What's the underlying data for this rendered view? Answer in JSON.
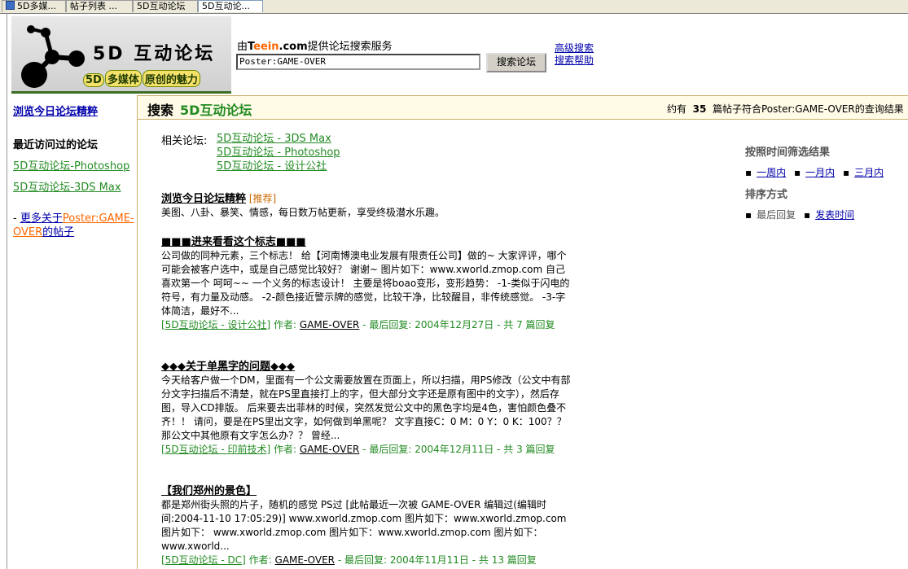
{
  "tabs": [
    {
      "label": "5D多媒..."
    },
    {
      "label": "帖子列表 ..."
    },
    {
      "label": "5D互动论坛"
    },
    {
      "label": "5D互动论..."
    }
  ],
  "logo": {
    "title": "5D 互动论坛",
    "slogan": [
      "5D",
      "多媒体",
      "原创的魅力"
    ]
  },
  "search": {
    "service_prefix": "由",
    "brand_a": "T",
    "brand_b": "eein",
    "brand_c": ".com",
    "service_suffix": "提供论坛搜索服务",
    "query": "Poster:GAME-OVER",
    "button": "搜索论坛",
    "advanced": "高级搜索",
    "help": "搜索帮助"
  },
  "sidebar": {
    "browse": "浏览今日论坛精粹",
    "recent_title": "最近访问过的论坛",
    "recent": [
      "5D互动论坛-Photoshop",
      "5D互动论坛-3DS Max"
    ],
    "more_prefix": "- ",
    "more_link1": "更多关于",
    "more_link2": "Poster:GAME-OVER",
    "more_link3": "的帖子"
  },
  "header": {
    "search_label": "搜索",
    "forum": "5D互动论坛",
    "count_prefix": "约有",
    "count": "35",
    "count_suffix": "篇帖子符合Poster:GAME-OVER的查询结果"
  },
  "related": {
    "label": "相关论坛:",
    "links": [
      "5D互动论坛 - 3DS Max",
      "5D互动论坛 - Photoshop",
      "5D互动论坛 - 设计公社"
    ]
  },
  "promo": {
    "title": "浏览今日论坛精粹",
    "tag": "[推荐]",
    "desc": "美图、八卦、暴笑、情感，每日数万帖更新，享受终极潜水乐趣。"
  },
  "results": [
    {
      "title": "■■■进来看看这个标志■■■",
      "snippet": "公司做的同种元素，三个标志！ 给【河南博澳电业发展有限责任公司】做的~ 大家评评，哪个可能会被客户选中，或是自己感觉比较好？ 谢谢~ 图片如下：www.xworld.zmop.com 自己喜欢第一个 呵呵~~ 一个义务的标志设计！ 主要是将boao变形，变形趋势： -1-类似于闪电的符号，有力量及动感。 -2-颜色接近警示牌的感觉，比较干净，比较醒目，非传统感觉。 -3-字体简洁，最好不...",
      "forum": "[5D互动论坛 - 设计公社]",
      "author_label": "作者:",
      "author": "GAME-OVER",
      "last": "- 最后回复: 2004年12月27日 - 共 7 篇回复"
    },
    {
      "title": "◆◆◆关于单黑字的问题◆◆◆",
      "snippet": "今天给客户做一个DM，里面有一个公文需要放置在页面上，所以扫描，用PS修改（公文中有部分文字扫描后不清楚，就在PS里直接打上的字，但大部分文字还是原有图中的文字），然后存图，导入CD排版。 后来要去出菲林的时候，突然发觉公文中的黑色字均是4色，害怕颜色叠不齐！！ 请问，要是在PS里出文字，如何做到单黑呢？ 文字直接C：0 M：0 Y：0 K：100？？那公文中其他原有文字怎么办？？ 曾经...",
      "forum": "[5D互动论坛 - 印前技术]",
      "author_label": "作者:",
      "author": "GAME-OVER",
      "last": "- 最后回复: 2004年12月11日 - 共 3 篇回复"
    },
    {
      "title": "【我们郑州的景色】",
      "snippet": "都是郑州街头照的片子，随机的感觉 PS过 [此帖最近一次被 GAME-OVER 编辑过(编辑时间:2004-11-10 17:05:29)] www.xworld.zmop.com 图片如下：www.xworld.zmop.com 图片如下： www.xworld.zmop.com 图片如下：www.xworld.zmop.com 图片如下： www.xworld...",
      "forum": "[5D互动论坛 - DC]",
      "author_label": "作者:",
      "author": "GAME-OVER",
      "last": "- 最后回复: 2004年11月11日 - 共 13 篇回复"
    }
  ],
  "filter": {
    "time_title": "按照时间筛选结果",
    "time": [
      "一周内",
      "一月内",
      "三月内"
    ],
    "sort_title": "排序方式",
    "sort_current": "最后回复",
    "sort_link": "发表时间"
  }
}
